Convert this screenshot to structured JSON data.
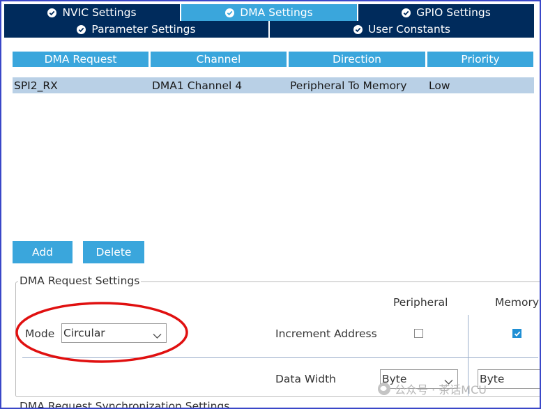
{
  "tabs_row1": [
    {
      "label": "NVIC Settings",
      "active": false
    },
    {
      "label": "DMA Settings",
      "active": true
    },
    {
      "label": "GPIO Settings",
      "active": false
    }
  ],
  "tabs_row2": [
    {
      "label": "Parameter Settings"
    },
    {
      "label": "User Constants"
    }
  ],
  "table": {
    "headers": [
      "DMA Request",
      "Channel",
      "Direction",
      "Priority"
    ],
    "rows": [
      {
        "request": "SPI2_RX",
        "channel": "DMA1 Channel 4",
        "direction": "Peripheral To Memory",
        "priority": "Low"
      }
    ]
  },
  "buttons": {
    "add": "Add",
    "delete": "Delete"
  },
  "settings": {
    "legend": "DMA Request Settings",
    "mode_label": "Mode",
    "mode_value": "Circular",
    "peripheral_header": "Peripheral",
    "memory_header": "Memory",
    "increment_label": "Increment Address",
    "peripheral_increment": false,
    "memory_increment": true,
    "data_width_label": "Data Width",
    "peripheral_width": "Byte",
    "memory_width": "Byte"
  },
  "sync_settings_legend": "DMA Request Synchronization Settings",
  "watermark": "公众号 · 茶话MCU",
  "colors": {
    "tab_dark": "#002b5c",
    "tab_active": "#3aa6dc",
    "row_selected": "#b9d0e6",
    "annotation_red": "#e01010"
  }
}
